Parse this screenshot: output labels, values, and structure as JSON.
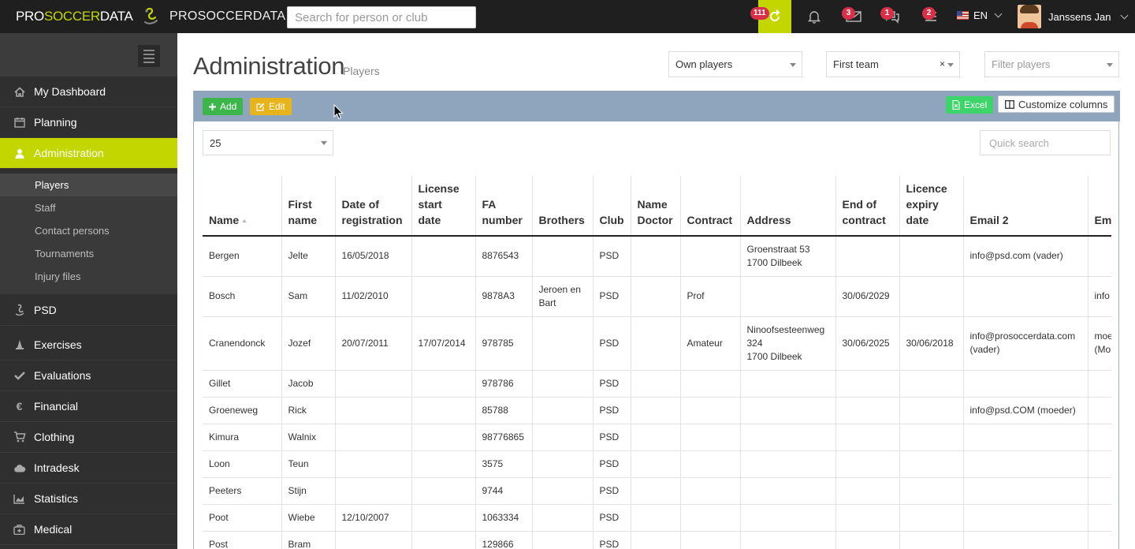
{
  "topbar": {
    "logo_part1": "PRO",
    "logo_part2": "SOCCER",
    "logo_part3": "DATA",
    "brand_name": "PROSOCCERDATA",
    "search_placeholder": "Search for person or club",
    "icons": [
      {
        "name": "refresh-icon",
        "badge": "111",
        "active": true
      },
      {
        "name": "bell-icon",
        "badge": ""
      },
      {
        "name": "envelope-icon",
        "badge": "3"
      },
      {
        "name": "chat-icon",
        "badge": "1"
      },
      {
        "name": "list-icon",
        "badge": "2"
      }
    ],
    "language": "EN",
    "user_name": "Janssens Jan"
  },
  "sidebar": {
    "items": [
      {
        "label": "My Dashboard",
        "icon": "home-icon"
      },
      {
        "label": "Planning",
        "icon": "calendar-icon"
      },
      {
        "label": "Administration",
        "icon": "user-icon",
        "active": true
      },
      {
        "label": "PSD",
        "icon": "psd-logo-icon"
      },
      {
        "label": "Exercises",
        "icon": "cones-icon"
      },
      {
        "label": "Evaluations",
        "icon": "check-icon"
      },
      {
        "label": "Financial",
        "icon": "euro-icon"
      },
      {
        "label": "Clothing",
        "icon": "cart-icon"
      },
      {
        "label": "Intradesk",
        "icon": "cloud-icon"
      },
      {
        "label": "Statistics",
        "icon": "chart-icon"
      },
      {
        "label": "Medical",
        "icon": "medkit-icon"
      }
    ],
    "subitems": [
      {
        "label": "Players",
        "active": true
      },
      {
        "label": "Staff"
      },
      {
        "label": "Contact persons"
      },
      {
        "label": "Tournaments"
      },
      {
        "label": "Injury files"
      }
    ]
  },
  "page": {
    "title": "Administration",
    "subtitle": "Players",
    "filter_own": "Own players",
    "filter_team": "First team",
    "filter_team_clear": "×",
    "filter_players_placeholder": "Filter players"
  },
  "toolbar": {
    "add_label": "Add",
    "edit_label": "Edit",
    "excel_label": "Excel",
    "customize_label": "Customize columns"
  },
  "list": {
    "page_size": "25",
    "quick_search_placeholder": "Quick search"
  },
  "table": {
    "columns": [
      "Name",
      "First\nname",
      "Date of\nregistration",
      "License\nstart\ndate",
      "FA\nnumber",
      "Brothers",
      "Club",
      "Name\nDoctor",
      "Contract",
      "Address",
      "End of\ncontract",
      "Licence\nexpiry\ndate",
      "Email 2",
      "Em"
    ],
    "rows": [
      [
        "Bergen",
        "Jelte",
        "16/05/2018",
        "",
        "8876543",
        "",
        "PSD",
        "",
        "",
        "Groenstraat 53\n1700 Dilbeek",
        "",
        "",
        "info@psd.com (vader)",
        ""
      ],
      [
        "Bosch",
        "Sam",
        "11/02/2010",
        "",
        "9878A3",
        "Jeroen en\nBart",
        "PSD",
        "",
        "Prof",
        "",
        "30/06/2029",
        "",
        "",
        "info"
      ],
      [
        "Cranendonck",
        "Jozef",
        "20/07/2011",
        "17/07/2014",
        "978785",
        "",
        "PSD",
        "",
        "Amateur",
        "Ninoofsesteenweg\n324\n1700 Dilbeek",
        "30/06/2025",
        "30/06/2018",
        "info@prosoccerdata.com\n(vader)",
        "moe\n(Mo"
      ],
      [
        "Gillet",
        "Jacob",
        "",
        "",
        "978786",
        "",
        "PSD",
        "",
        "",
        "",
        "",
        "",
        "",
        ""
      ],
      [
        "Groeneweg",
        "Rick",
        "",
        "",
        "85788",
        "",
        "PSD",
        "",
        "",
        "",
        "",
        "",
        "info@psd.COM (moeder)",
        ""
      ],
      [
        "Kimura",
        "Walnix",
        "",
        "",
        "98776865",
        "",
        "PSD",
        "",
        "",
        "",
        "",
        "",
        "",
        ""
      ],
      [
        "Loon",
        "Teun",
        "",
        "",
        "3575",
        "",
        "PSD",
        "",
        "",
        "",
        "",
        "",
        "",
        ""
      ],
      [
        "Peeters",
        "Stijn",
        "",
        "",
        "9744",
        "",
        "PSD",
        "",
        "",
        "",
        "",
        "",
        "",
        ""
      ],
      [
        "Poot",
        "Wiebe",
        "12/10/2007",
        "",
        "1063334",
        "",
        "PSD",
        "",
        "",
        "",
        "",
        "",
        "",
        ""
      ],
      [
        "Post",
        "Bram",
        "",
        "",
        "129866",
        "",
        "PSD",
        "",
        "",
        "",
        "",
        "",
        "",
        ""
      ]
    ]
  }
}
